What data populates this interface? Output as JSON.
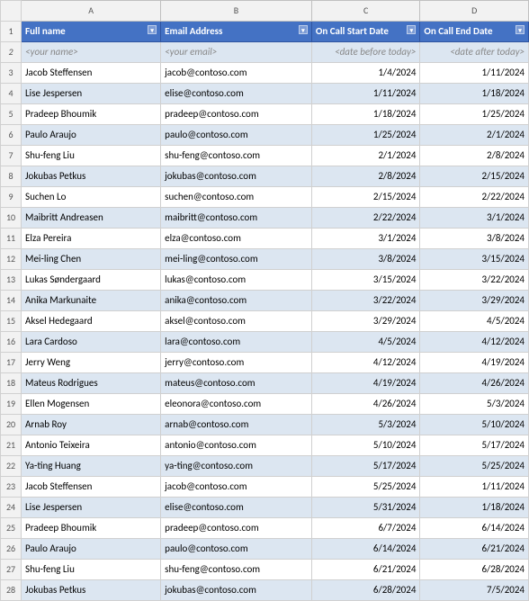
{
  "headers": {
    "row_num": "",
    "col_a": "Full name",
    "col_b": "Email Address",
    "col_c": "On Call Start Date",
    "col_d": "On Call End Date"
  },
  "rows": [
    {
      "row": "2",
      "a": "<your name>",
      "b": "<your email>",
      "c": "<date before today>",
      "d": "<date after today>",
      "template": true
    },
    {
      "row": "3",
      "a": "Jacob Steffensen",
      "b": "jacob@contoso.com",
      "c": "1/4/2024",
      "d": "1/11/2024",
      "template": false
    },
    {
      "row": "4",
      "a": "Lise Jespersen",
      "b": "elise@contoso.com",
      "c": "1/11/2024",
      "d": "1/18/2024",
      "template": false
    },
    {
      "row": "5",
      "a": "Pradeep Bhoumik",
      "b": "pradeep@contoso.com",
      "c": "1/18/2024",
      "d": "1/25/2024",
      "template": false
    },
    {
      "row": "6",
      "a": "Paulo Araujo",
      "b": "paulo@contoso.com",
      "c": "1/25/2024",
      "d": "2/1/2024",
      "template": false
    },
    {
      "row": "7",
      "a": "Shu-feng Liu",
      "b": "shu-feng@contoso.com",
      "c": "2/1/2024",
      "d": "2/8/2024",
      "template": false
    },
    {
      "row": "8",
      "a": "Jokubas Petkus",
      "b": "jokubas@contoso.com",
      "c": "2/8/2024",
      "d": "2/15/2024",
      "template": false
    },
    {
      "row": "9",
      "a": "Suchen Lo",
      "b": "suchen@contoso.com",
      "c": "2/15/2024",
      "d": "2/22/2024",
      "template": false
    },
    {
      "row": "10",
      "a": "Maibritt Andreasen",
      "b": "maibritt@contoso.com",
      "c": "2/22/2024",
      "d": "3/1/2024",
      "template": false
    },
    {
      "row": "11",
      "a": "Elza Pereira",
      "b": "elza@contoso.com",
      "c": "3/1/2024",
      "d": "3/8/2024",
      "template": false
    },
    {
      "row": "12",
      "a": "Mei-ling Chen",
      "b": "mei-ling@contoso.com",
      "c": "3/8/2024",
      "d": "3/15/2024",
      "template": false
    },
    {
      "row": "13",
      "a": "Lukas Søndergaard",
      "b": "lukas@contoso.com",
      "c": "3/15/2024",
      "d": "3/22/2024",
      "template": false
    },
    {
      "row": "14",
      "a": "Anika Markunaite",
      "b": "anika@contoso.com",
      "c": "3/22/2024",
      "d": "3/29/2024",
      "template": false
    },
    {
      "row": "15",
      "a": "Aksel Hedegaard",
      "b": "aksel@contoso.com",
      "c": "3/29/2024",
      "d": "4/5/2024",
      "template": false
    },
    {
      "row": "16",
      "a": "Lara Cardoso",
      "b": "lara@contoso.com",
      "c": "4/5/2024",
      "d": "4/12/2024",
      "template": false
    },
    {
      "row": "17",
      "a": "Jerry Weng",
      "b": "jerry@contoso.com",
      "c": "4/12/2024",
      "d": "4/19/2024",
      "template": false
    },
    {
      "row": "18",
      "a": "Mateus Rodrigues",
      "b": "mateus@contoso.com",
      "c": "4/19/2024",
      "d": "4/26/2024",
      "template": false
    },
    {
      "row": "19",
      "a": "Ellen Mogensen",
      "b": "eleonora@contoso.com",
      "c": "4/26/2024",
      "d": "5/3/2024",
      "template": false
    },
    {
      "row": "20",
      "a": "Arnab Roy",
      "b": "arnab@contoso.com",
      "c": "5/3/2024",
      "d": "5/10/2024",
      "template": false
    },
    {
      "row": "21",
      "a": "Antonio Teixeira",
      "b": "antonio@contoso.com",
      "c": "5/10/2024",
      "d": "5/17/2024",
      "template": false
    },
    {
      "row": "22",
      "a": "Ya-ting Huang",
      "b": "ya-ting@contoso.com",
      "c": "5/17/2024",
      "d": "5/25/2024",
      "template": false
    },
    {
      "row": "23",
      "a": "Jacob Steffensen",
      "b": "jacob@contoso.com",
      "c": "5/25/2024",
      "d": "1/11/2024",
      "template": false
    },
    {
      "row": "24",
      "a": "Lise Jespersen",
      "b": "elise@contoso.com",
      "c": "5/31/2024",
      "d": "1/18/2024",
      "template": false
    },
    {
      "row": "25",
      "a": "Pradeep Bhoumik",
      "b": "pradeep@contoso.com",
      "c": "6/7/2024",
      "d": "6/14/2024",
      "template": false
    },
    {
      "row": "26",
      "a": "Paulo Araujo",
      "b": "paulo@contoso.com",
      "c": "6/14/2024",
      "d": "6/21/2024",
      "template": false
    },
    {
      "row": "27",
      "a": "Shu-feng Liu",
      "b": "shu-feng@contoso.com",
      "c": "6/21/2024",
      "d": "6/28/2024",
      "template": false
    },
    {
      "row": "28",
      "a": "Jokubas Petkus",
      "b": "jokubas@contoso.com",
      "c": "6/28/2024",
      "d": "7/5/2024",
      "template": false
    }
  ]
}
